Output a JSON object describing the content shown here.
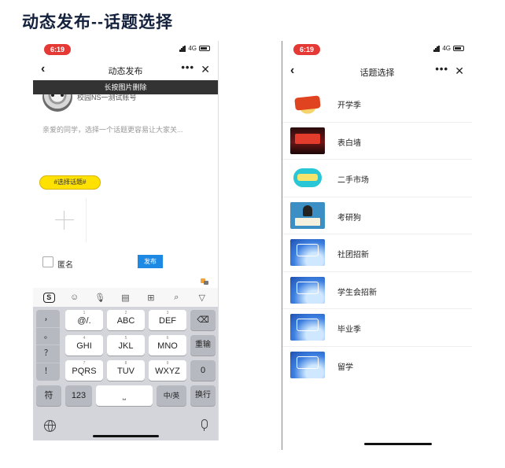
{
  "page_title": "动态发布--话题选择",
  "publish_screen": {
    "status": {
      "time": "6:19",
      "network": "4G"
    },
    "nav": {
      "back": "‹",
      "title": "动态发布",
      "more": "•••",
      "close": "✕"
    },
    "toast": "长按图片删除",
    "account_name": "校园NS一测试账号",
    "placeholder": "亲爱的同学，选择一个话题更容易让大家关...",
    "topic_chip": "#选择话题#",
    "anonymous_label": "匿名",
    "publish_button": "发布",
    "keyboard": {
      "toolbar_icons": [
        "sogou-logo-icon",
        "emoji-icon",
        "voice-icon",
        "clipboard-icon",
        "apps-icon",
        "search-icon",
        "collapse-keyboard-icon"
      ],
      "symbol_keys": [
        "，",
        "。",
        "？",
        "！"
      ],
      "row1": [
        {
          "hint": "1",
          "label": "@/."
        },
        {
          "hint": "2",
          "label": "ABC"
        },
        {
          "hint": "3",
          "label": "DEF"
        }
      ],
      "row2": [
        {
          "hint": "4",
          "label": "GHI"
        },
        {
          "hint": "5",
          "label": "JKL"
        },
        {
          "hint": "6",
          "label": "MNO"
        }
      ],
      "row3": [
        {
          "hint": "7",
          "label": "PQRS"
        },
        {
          "hint": "8",
          "label": "TUV"
        },
        {
          "hint": "9",
          "label": "WXYZ"
        }
      ],
      "side_keys": {
        "backspace": "⌫",
        "reenter": "重输",
        "zero": "0"
      },
      "bottom_row": {
        "symbol": "符",
        "numbers": "123",
        "space": "⎵",
        "lang": "中/英",
        "enter": "换行"
      }
    }
  },
  "topic_screen": {
    "status": {
      "time": "6:19",
      "network": "4G"
    },
    "nav": {
      "back": "‹",
      "title": "话题选择",
      "more": "•••",
      "close": "✕"
    },
    "topics": [
      {
        "label": "开学季",
        "thumb": "thumb-kaixue"
      },
      {
        "label": "表白墙",
        "thumb": "thumb-biaobai"
      },
      {
        "label": "二手市场",
        "thumb": "thumb-ershou"
      },
      {
        "label": "考研狗",
        "thumb": "thumb-kaoyan"
      },
      {
        "label": "社团招新",
        "thumb": "thumb-liuxue"
      },
      {
        "label": "学生会招新",
        "thumb": "thumb-liuxue"
      },
      {
        "label": "毕业季",
        "thumb": "thumb-liuxue"
      },
      {
        "label": "留学",
        "thumb": "thumb-liuxue"
      }
    ]
  }
}
